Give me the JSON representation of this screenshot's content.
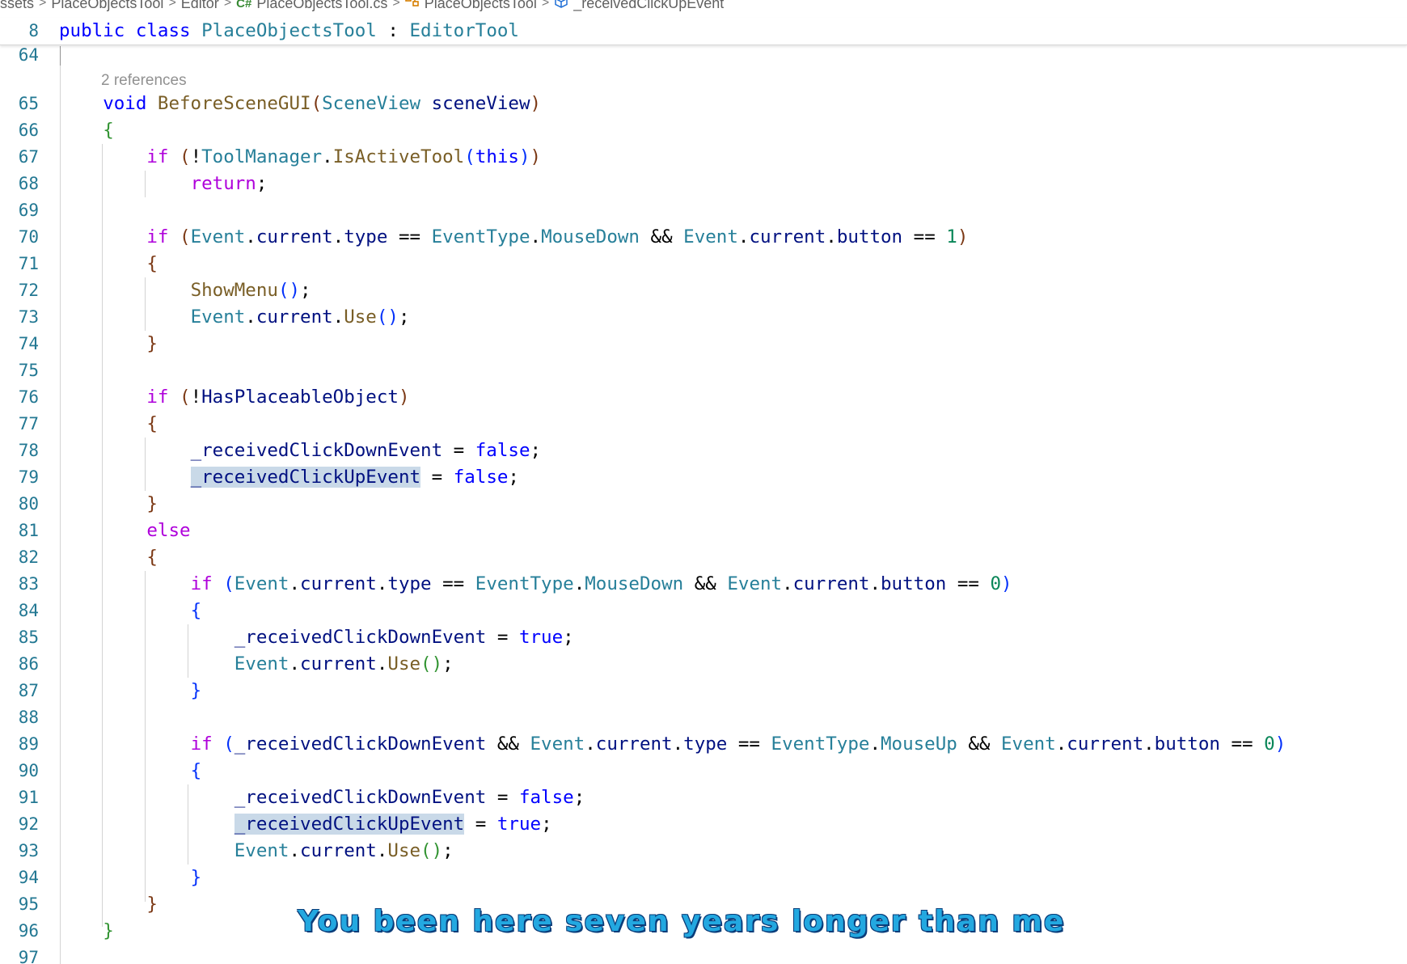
{
  "breadcrumb": {
    "items": [
      "ssets",
      "PlaceObjectsTool",
      "Editor",
      "PlaceObjectsTool.cs",
      "PlaceObjectsTool",
      "_receivedClickUpEvent"
    ],
    "separator": ">",
    "icons": [
      "cs-file-icon",
      "class-icon",
      "field-icon"
    ]
  },
  "sticky": {
    "line_number": "8",
    "tokens": [
      "public",
      "class",
      "PlaceObjectsTool",
      ":",
      "EditorTool"
    ]
  },
  "codelens": "2 references",
  "lines": {
    "l64": "64",
    "l65": "65",
    "l66": "66",
    "l67": "67",
    "l68": "68",
    "l69": "69",
    "l70": "70",
    "l71": "71",
    "l72": "72",
    "l73": "73",
    "l74": "74",
    "l75": "75",
    "l76": "76",
    "l77": "77",
    "l78": "78",
    "l79": "79",
    "l80": "80",
    "l81": "81",
    "l82": "82",
    "l83": "83",
    "l84": "84",
    "l85": "85",
    "l86": "86",
    "l87": "87",
    "l88": "88",
    "l89": "89",
    "l90": "90",
    "l91": "91",
    "l92": "92",
    "l93": "93",
    "l94": "94",
    "l95": "95",
    "l96": "96",
    "l97": "97"
  },
  "tok": {
    "void": "void",
    "if": "if",
    "else": "else",
    "return": "return",
    "this": "this",
    "false": "false",
    "true": "true",
    "BeforeSceneGUI": "BeforeSceneGUI",
    "SceneView": "SceneView",
    "sceneView": "sceneView",
    "ToolManager": "ToolManager",
    "IsActiveTool": "IsActiveTool",
    "Event": "Event",
    "current": "current",
    "type": "type",
    "button": "button",
    "EventType": "EventType",
    "MouseDown": "MouseDown",
    "MouseUp": "MouseUp",
    "ShowMenu": "ShowMenu",
    "Use": "Use",
    "HasPlaceableObject": "HasPlaceableObject",
    "receivedClickDownEvent": "_receivedClickDownEvent",
    "receivedClickUpEvent": "_receivedClickUpEvent",
    "one": "1",
    "zero": "0"
  },
  "caption": "You been here seven years longer than me",
  "colors": {
    "keyword": "#0000ff",
    "control": "#af00db",
    "type": "#267f99",
    "function": "#795e26",
    "variable": "#001080",
    "number": "#098658",
    "line_number": "#237893",
    "highlight": "#c9d9e8",
    "caption": "#23a8e0"
  }
}
